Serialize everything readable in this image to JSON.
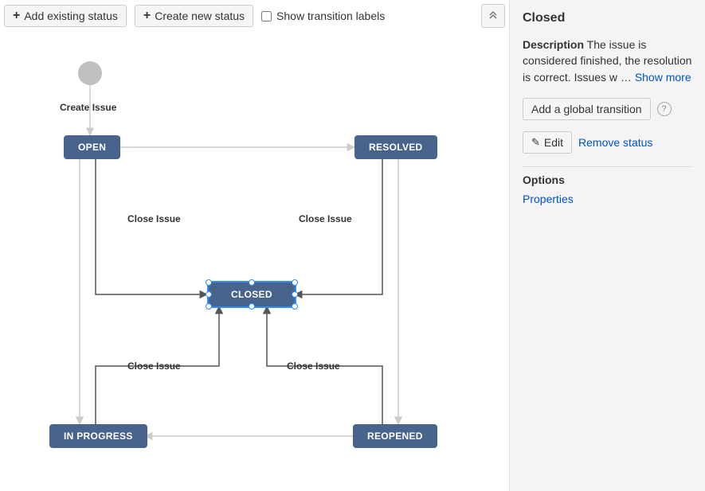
{
  "toolbar": {
    "add_existing_label": "Add existing status",
    "create_new_label": "Create new status",
    "show_labels_label": "Show transition labels"
  },
  "diagram": {
    "nodes": {
      "open": "OPEN",
      "resolved": "RESOLVED",
      "closed": "CLOSED",
      "in_progress": "IN PROGRESS",
      "reopened": "REOPENED"
    },
    "transitions": {
      "create_issue": "Create Issue",
      "close_issue_1": "Close Issue",
      "close_issue_2": "Close Issue",
      "close_issue_3": "Close Issue",
      "close_issue_4": "Close Issue"
    }
  },
  "panel": {
    "title": "Closed",
    "desc_label": "Description",
    "desc_text": "The issue is considered finished, the resolution is correct. Issues w",
    "ellipsis": "…",
    "show_more": "Show more",
    "add_global_label": "Add a global transition",
    "edit_label": "Edit",
    "remove_label": "Remove status",
    "options_heading": "Options",
    "properties_link": "Properties"
  }
}
